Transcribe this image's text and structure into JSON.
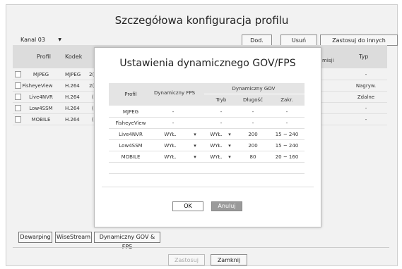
{
  "window": {
    "title": "Szczegółowa konfiguracja profilu"
  },
  "channel": {
    "value": "Kanal 03"
  },
  "actions": {
    "add": "Dod.",
    "remove": "Usuń",
    "apply_other": "Zastosuj do innych kanałów"
  },
  "profile_table": {
    "headers": {
      "profile": "Profil",
      "codec": "Kodek",
      "type": "Typ",
      "partial": "misji"
    },
    "rows": [
      {
        "profile": "MJPEG",
        "codec": "MJPEG",
        "partial": "2(",
        "type": "-"
      },
      {
        "profile": "FisheyeView",
        "codec": "H.264",
        "partial": "2(",
        "type": "Nagryw."
      },
      {
        "profile": "Live4NVR",
        "codec": "H.264",
        "partial": "(",
        "type": "Zdalne"
      },
      {
        "profile": "Low4SSM",
        "codec": "H.264",
        "partial": "(",
        "type": "-"
      },
      {
        "profile": "MOBILE",
        "codec": "H.264",
        "partial": "(",
        "type": "-"
      }
    ]
  },
  "bottom_buttons": {
    "dewarping": "Dewarping",
    "wisestream": "WiseStream",
    "dynamic": "Dynamiczny GOV & FPS"
  },
  "footer": {
    "apply": "Zastosuj",
    "close": "Zamknij"
  },
  "dialog": {
    "title": "Ustawienia dynamicznego GOV/FPS",
    "headers": {
      "profile": "Profil",
      "dyn_fps": "Dynamiczny FPS",
      "dyn_gov": "Dynamiczny GOV",
      "mode": "Tryb",
      "length": "Długość",
      "range": "Zakr."
    },
    "rows": [
      {
        "profile": "MJPEG",
        "fps": "-",
        "mode": "-",
        "length": "-",
        "range": "-"
      },
      {
        "profile": "FisheyeView",
        "fps": "-",
        "mode": "-",
        "length": "-",
        "range": "-"
      },
      {
        "profile": "Live4NVR",
        "fps": "WYŁ.",
        "mode": "WYŁ.",
        "length": "200",
        "range": "15 ~ 240"
      },
      {
        "profile": "Low4SSM",
        "fps": "WYŁ.",
        "mode": "WYŁ.",
        "length": "200",
        "range": "15 ~ 240"
      },
      {
        "profile": "MOBILE",
        "fps": "WYŁ.",
        "mode": "WYŁ.",
        "length": "80",
        "range": "20 ~ 160"
      }
    ],
    "ok": "OK",
    "cancel": "Anuluj"
  }
}
